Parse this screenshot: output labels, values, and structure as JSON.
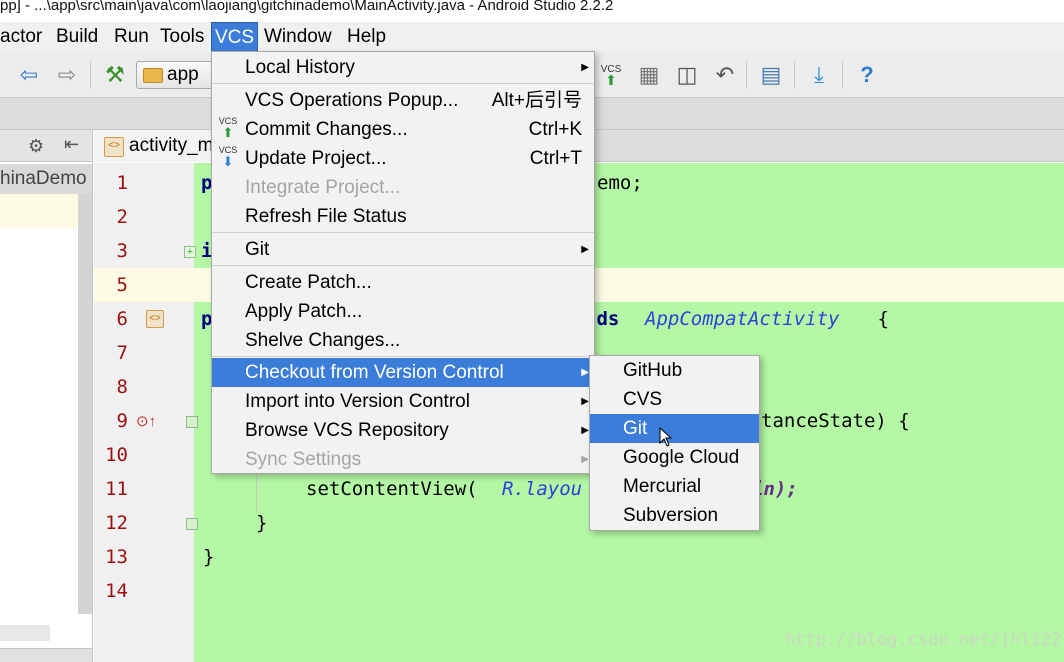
{
  "window": {
    "title": "pp] - ...\\app\\src\\main\\java\\com\\laojiang\\gitchinademo\\MainActivity.java - Android Studio 2.2.2"
  },
  "menubar": {
    "items": [
      "actor",
      "Build",
      "Run",
      "Tools",
      "VCS",
      "Window",
      "Help"
    ],
    "active": "VCS"
  },
  "toolbar": {
    "run_config": "app"
  },
  "project_panel": {
    "label": "hinaDemo"
  },
  "editor": {
    "tab_label": "activity_m",
    "line_numbers": [
      "1",
      "2",
      "3",
      "5",
      "6",
      "7",
      "8",
      "9",
      "10",
      "11",
      "12",
      "13",
      "14"
    ],
    "code_fragments": {
      "line1_start": "p",
      "line1_end": "emo;",
      "line3_start": "i",
      "line6_start": "p",
      "line6_ext": "nds ",
      "line6_class": "AppCompatActivity",
      "line6_brace": " {",
      "line9_end": "tanceState) {",
      "line11_call": "setContentView(",
      "line11_ref": "R.layou",
      "line11_end": "in);",
      "line12": "}",
      "line13": "}"
    }
  },
  "vcs_menu": {
    "items": [
      {
        "label": "Local History",
        "shortcut": "",
        "submenu": true,
        "enabled": true
      },
      {
        "label": "VCS Operations Popup...",
        "shortcut": "Alt+后引号",
        "submenu": false,
        "enabled": true
      },
      {
        "label": "Commit Changes...",
        "shortcut": "Ctrl+K",
        "submenu": false,
        "enabled": true,
        "icon": "vcs-commit-icon"
      },
      {
        "label": "Update Project...",
        "shortcut": "Ctrl+T",
        "submenu": false,
        "enabled": true,
        "icon": "vcs-update-icon"
      },
      {
        "label": "Integrate Project...",
        "shortcut": "",
        "submenu": false,
        "enabled": false
      },
      {
        "label": "Refresh File Status",
        "shortcut": "",
        "submenu": false,
        "enabled": true
      },
      {
        "label": "Git",
        "shortcut": "",
        "submenu": true,
        "enabled": true
      },
      {
        "label": "Create Patch...",
        "shortcut": "",
        "submenu": false,
        "enabled": true
      },
      {
        "label": "Apply Patch...",
        "shortcut": "",
        "submenu": false,
        "enabled": true
      },
      {
        "label": "Shelve Changes...",
        "shortcut": "",
        "submenu": false,
        "enabled": true
      },
      {
        "label": "Checkout from Version Control",
        "shortcut": "",
        "submenu": true,
        "enabled": true,
        "selected": true
      },
      {
        "label": "Import into Version Control",
        "shortcut": "",
        "submenu": true,
        "enabled": true
      },
      {
        "label": "Browse VCS Repository",
        "shortcut": "",
        "submenu": true,
        "enabled": true
      },
      {
        "label": "Sync Settings",
        "shortcut": "",
        "submenu": true,
        "enabled": false
      }
    ],
    "icon_text": "VCS"
  },
  "checkout_submenu": {
    "items": [
      "GitHub",
      "CVS",
      "Git",
      "Google Cloud",
      "Mercurial",
      "Subversion"
    ],
    "selected": "Git"
  },
  "watermark": "http://blog.csdn.net/jhl122",
  "colors": {
    "selection": "#3b7dd8",
    "editor_bg": "#b4f8a5",
    "line_number": "#9b1010"
  }
}
